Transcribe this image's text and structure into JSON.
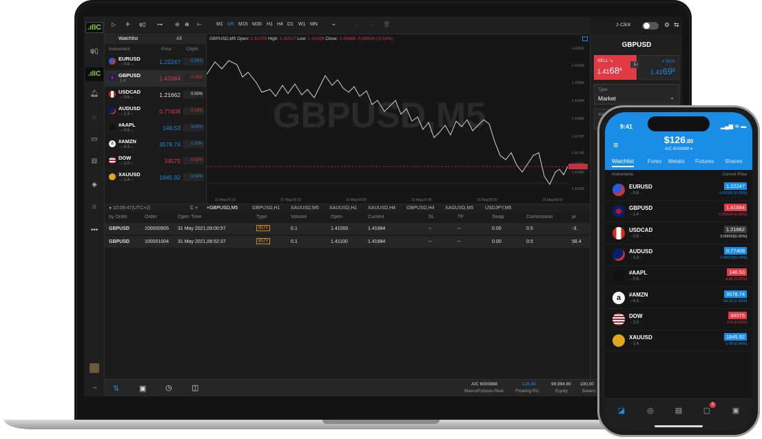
{
  "desktop": {
    "logo": ".ılIC",
    "toolbar": {
      "tools": [
        "▷",
        "✛",
        "φ▯",
        "⊶",
        "⊖",
        "⊕",
        "⊢"
      ],
      "timeframes": [
        "M1",
        "M5",
        "M15",
        "M30",
        "H1",
        "H4",
        "D1",
        "W1",
        "MN"
      ],
      "active_timeframe": "M5",
      "one_click": "1-Click",
      "undo": "←",
      "redo": "→",
      "delete": "🗑"
    },
    "watchlist": {
      "tab_watchlist": "Watchlist",
      "tab_all": "All",
      "col_instrument": "Instrument",
      "col_price": "Price",
      "col_chg": "Chg%",
      "rows": [
        {
          "symbol": "EURUSD",
          "sub": "-- 0.8 --",
          "price": "1.22247",
          "chg": "0.05%",
          "dir": "up",
          "flag": "eu"
        },
        {
          "symbol": "GBPUSD",
          "sub": "1.4",
          "price": "1.41684",
          "chg": "-0.06%",
          "dir": "down",
          "flag": "gb"
        },
        {
          "symbol": "USDCAD",
          "sub": "-- 0.6 --",
          "price": "1.21662",
          "chg": "0.00%",
          "dir": "flat",
          "flag": "ca"
        },
        {
          "symbol": "AUDUSD",
          "sub": "-- 1.3 --",
          "price": "0.77408",
          "chg": "0.14%",
          "dir": "down",
          "flag": "au"
        },
        {
          "symbol": "#AAPL",
          "sub": "-- 0.6 --",
          "price": "146.53",
          "chg": "3.02%",
          "dir": "up",
          "flag": "apple"
        },
        {
          "symbol": "#AMZN",
          "sub": "-- 4.3 --",
          "price": "3578.74",
          "chg": "1.20%",
          "dir": "up",
          "flag": "amazon"
        },
        {
          "symbol": "DOW",
          "sub": "-- 1.0 --",
          "price": "34575",
          "chg": "0.52%",
          "dir": "down",
          "flag": "us"
        },
        {
          "symbol": "XAUUSD",
          "sub": "-- 1.4 --",
          "price": "1845.92",
          "chg": "0.54%",
          "dir": "up",
          "flag": "gold"
        }
      ]
    },
    "chart": {
      "header": "GBPUSD,M5 Open:",
      "open": "1.41709",
      "high_label": "High:",
      "high": "1.42017",
      "low_label": "Low:",
      "low": "1.41028",
      "close_label": "Close:",
      "close": "1.41684 -0.00024 (-0.01%)",
      "watermark": "GBPUSD,M5",
      "y_ticks": [
        "1.42592",
        "1.42095",
        "1.41956",
        "1.41904",
        "1.41856",
        "1.41797",
        "1.41742",
        "1.41684",
        "1.41682",
        "1.41633"
      ],
      "x_ticks": [
        "31 May,05:15",
        "31 May,06:10",
        "31 May,06:55",
        "31 May,07:40",
        "31 May,08:20",
        "31 May,09:15"
      ]
    },
    "order": {
      "symbol": "GBPUSD",
      "sell_label": "SELL ↘",
      "sell_price_a": "1.41",
      "sell_price_b": "68",
      "sell_price_c": "4",
      "spread": "1.4",
      "buy_label": "↗ BUY",
      "buy_price_a": "1.41",
      "buy_price_b": "69",
      "buy_price_c": "8",
      "type_label": "Type",
      "type_value": "Market",
      "vol_label": "Vol"
    },
    "bottom_tabs": {
      "time": "● 10:09:47(UTC+2)",
      "tabs": [
        "×GBPUSD,M5",
        "GBPUSD,H1",
        "XAUUSD,M5",
        "XAUUSD,H1",
        "XAUUSD,H4",
        "GBPUSD,H4",
        "XAGUSD,M5",
        "USDJPY,M5"
      ]
    },
    "table": {
      "headers": [
        "by Order",
        "Order",
        "Open Time",
        "Type",
        "Volume",
        "Open",
        "Current",
        "SL",
        "TP",
        "Swap",
        "Commission",
        "pi"
      ],
      "rows": [
        [
          "GBPUSD",
          "100000905",
          "31 May 2021,09:00:57",
          "BUY",
          "0.1",
          "1.41000",
          "1.41684",
          "--",
          "--",
          "0.00",
          "0.5",
          "-3."
        ],
        [
          "GBPUSD",
          "100001004",
          "31 May 2021,08:52:37",
          "BUY",
          "0.1",
          "1.41100",
          "1.41684",
          "--",
          "--",
          "0.00",
          "0.5",
          "58.4"
        ]
      ]
    },
    "status": {
      "account": "A/C 6000888",
      "server": "MaxcoFutures-Real",
      "floating_value": "126.80",
      "floating_label": "Floating P/L",
      "equity_value": "99,994.80",
      "equity_label": "Equity",
      "balance_value": "100,00",
      "balance_label": "Balanc"
    }
  },
  "phone": {
    "time": "9:41",
    "balance_main": "$126",
    "balance_dec": ".80",
    "account": "A/C 6000888 ▾",
    "tabs": [
      "Watchlist",
      "Forex",
      "Metals",
      "Futures",
      "Shares"
    ],
    "col_instruments": "Instruments",
    "col_current": "Current Price",
    "rows": [
      {
        "symbol": "EURUSD",
        "sub": "- 0.8 -",
        "price": "1.22247",
        "chg": "0.00105 [0.05%]",
        "color": "#1a8ee6",
        "flag": "eu"
      },
      {
        "symbol": "GBPUSD",
        "sub": "- 1.4 -",
        "price": "1.41684",
        "chg": "-0.00024 [0.06%]",
        "color": "#e03a45",
        "flag": "gb"
      },
      {
        "symbol": "USDCAD",
        "sub": "- 0.6 -",
        "price": "1.21662",
        "chg": "0.00000[0.00%]",
        "color": "#3a3a3a",
        "flag": "ca"
      },
      {
        "symbol": "AUDUSD",
        "sub": "- 1.3 -",
        "price": "0.77408",
        "chg": "0.00169[0.14%]",
        "color": "#1a8ee6",
        "flag": "au"
      },
      {
        "symbol": "#AAPL",
        "sub": "- 0.6 -",
        "price": "146.53",
        "chg": "4.65 [3.02%]",
        "color": "#e03a45",
        "flag": "apple"
      },
      {
        "symbol": "#AMZN",
        "sub": "- 4.3 -",
        "price": "3578.74",
        "chg": "54.35 [1.30%]",
        "color": "#1a8ee6",
        "flag": "amazon"
      },
      {
        "symbol": "DOW",
        "sub": "- 1.0 -",
        "price": "34575",
        "chg": "175 [0.52%]",
        "color": "#e03a45",
        "flag": "us"
      },
      {
        "symbol": "XAUUSD",
        "sub": "- 1.4 -",
        "price": "1845.92",
        "chg": "5.09 [0.54%]",
        "color": "#1a8ee6",
        "flag": "gold"
      }
    ],
    "notif_badge": "2"
  },
  "colors": {
    "up": "#1a8ee6",
    "down": "#e03a45",
    "flat": "#e0e0e0",
    "accent": "#1a8ee6"
  }
}
